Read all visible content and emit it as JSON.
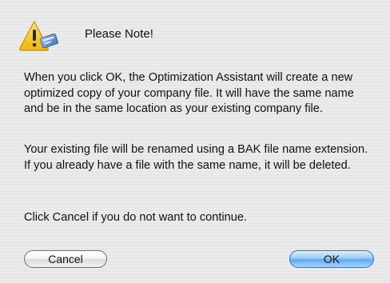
{
  "dialog": {
    "title": "Please Note!",
    "paragraphs": [
      "When you click OK, the Optimization Assistant will create a new optimized copy of your company file.  It will have the same name and be in the same location as your existing company file.",
      "Your existing file will be renamed using a BAK file name extension.  If you already have a file with the same name, it will be deleted.",
      "Click Cancel if you do not want to continue."
    ],
    "icon": "warning-triangle-icon"
  },
  "buttons": {
    "cancel_label": "Cancel",
    "ok_label": "OK"
  },
  "colors": {
    "warning_yellow": "#f7c51c",
    "default_button_blue": "#5ea9ee",
    "background": "#e8e8e8"
  }
}
